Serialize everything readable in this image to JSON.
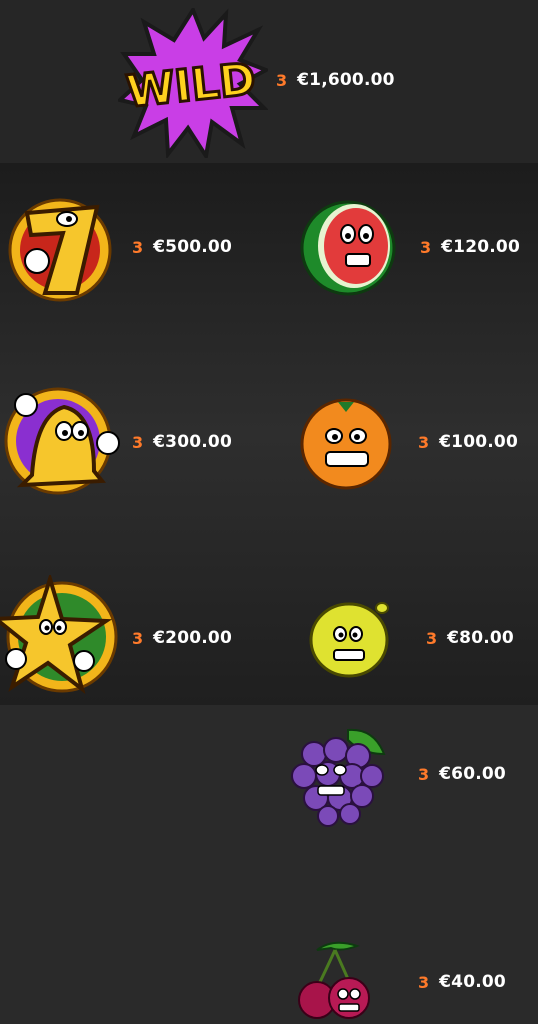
{
  "paytable": [
    {
      "symbol": "wild",
      "count": "3",
      "value": "€1,600.00",
      "label": "WILD"
    },
    {
      "symbol": "seven",
      "count": "3",
      "value": "€500.00"
    },
    {
      "symbol": "watermelon",
      "count": "3",
      "value": "€120.00"
    },
    {
      "symbol": "bell",
      "count": "3",
      "value": "€300.00"
    },
    {
      "symbol": "orange",
      "count": "3",
      "value": "€100.00"
    },
    {
      "symbol": "star",
      "count": "3",
      "value": "€200.00"
    },
    {
      "symbol": "lemon",
      "count": "3",
      "value": "€80.00"
    },
    {
      "symbol": "grapes",
      "count": "3",
      "value": "€60.00"
    },
    {
      "symbol": "cherries",
      "count": "3",
      "value": "€40.00"
    }
  ],
  "colors": {
    "count": "#ff7a2a",
    "value": "#ffffff",
    "wild_burst": "#c93ee6"
  }
}
